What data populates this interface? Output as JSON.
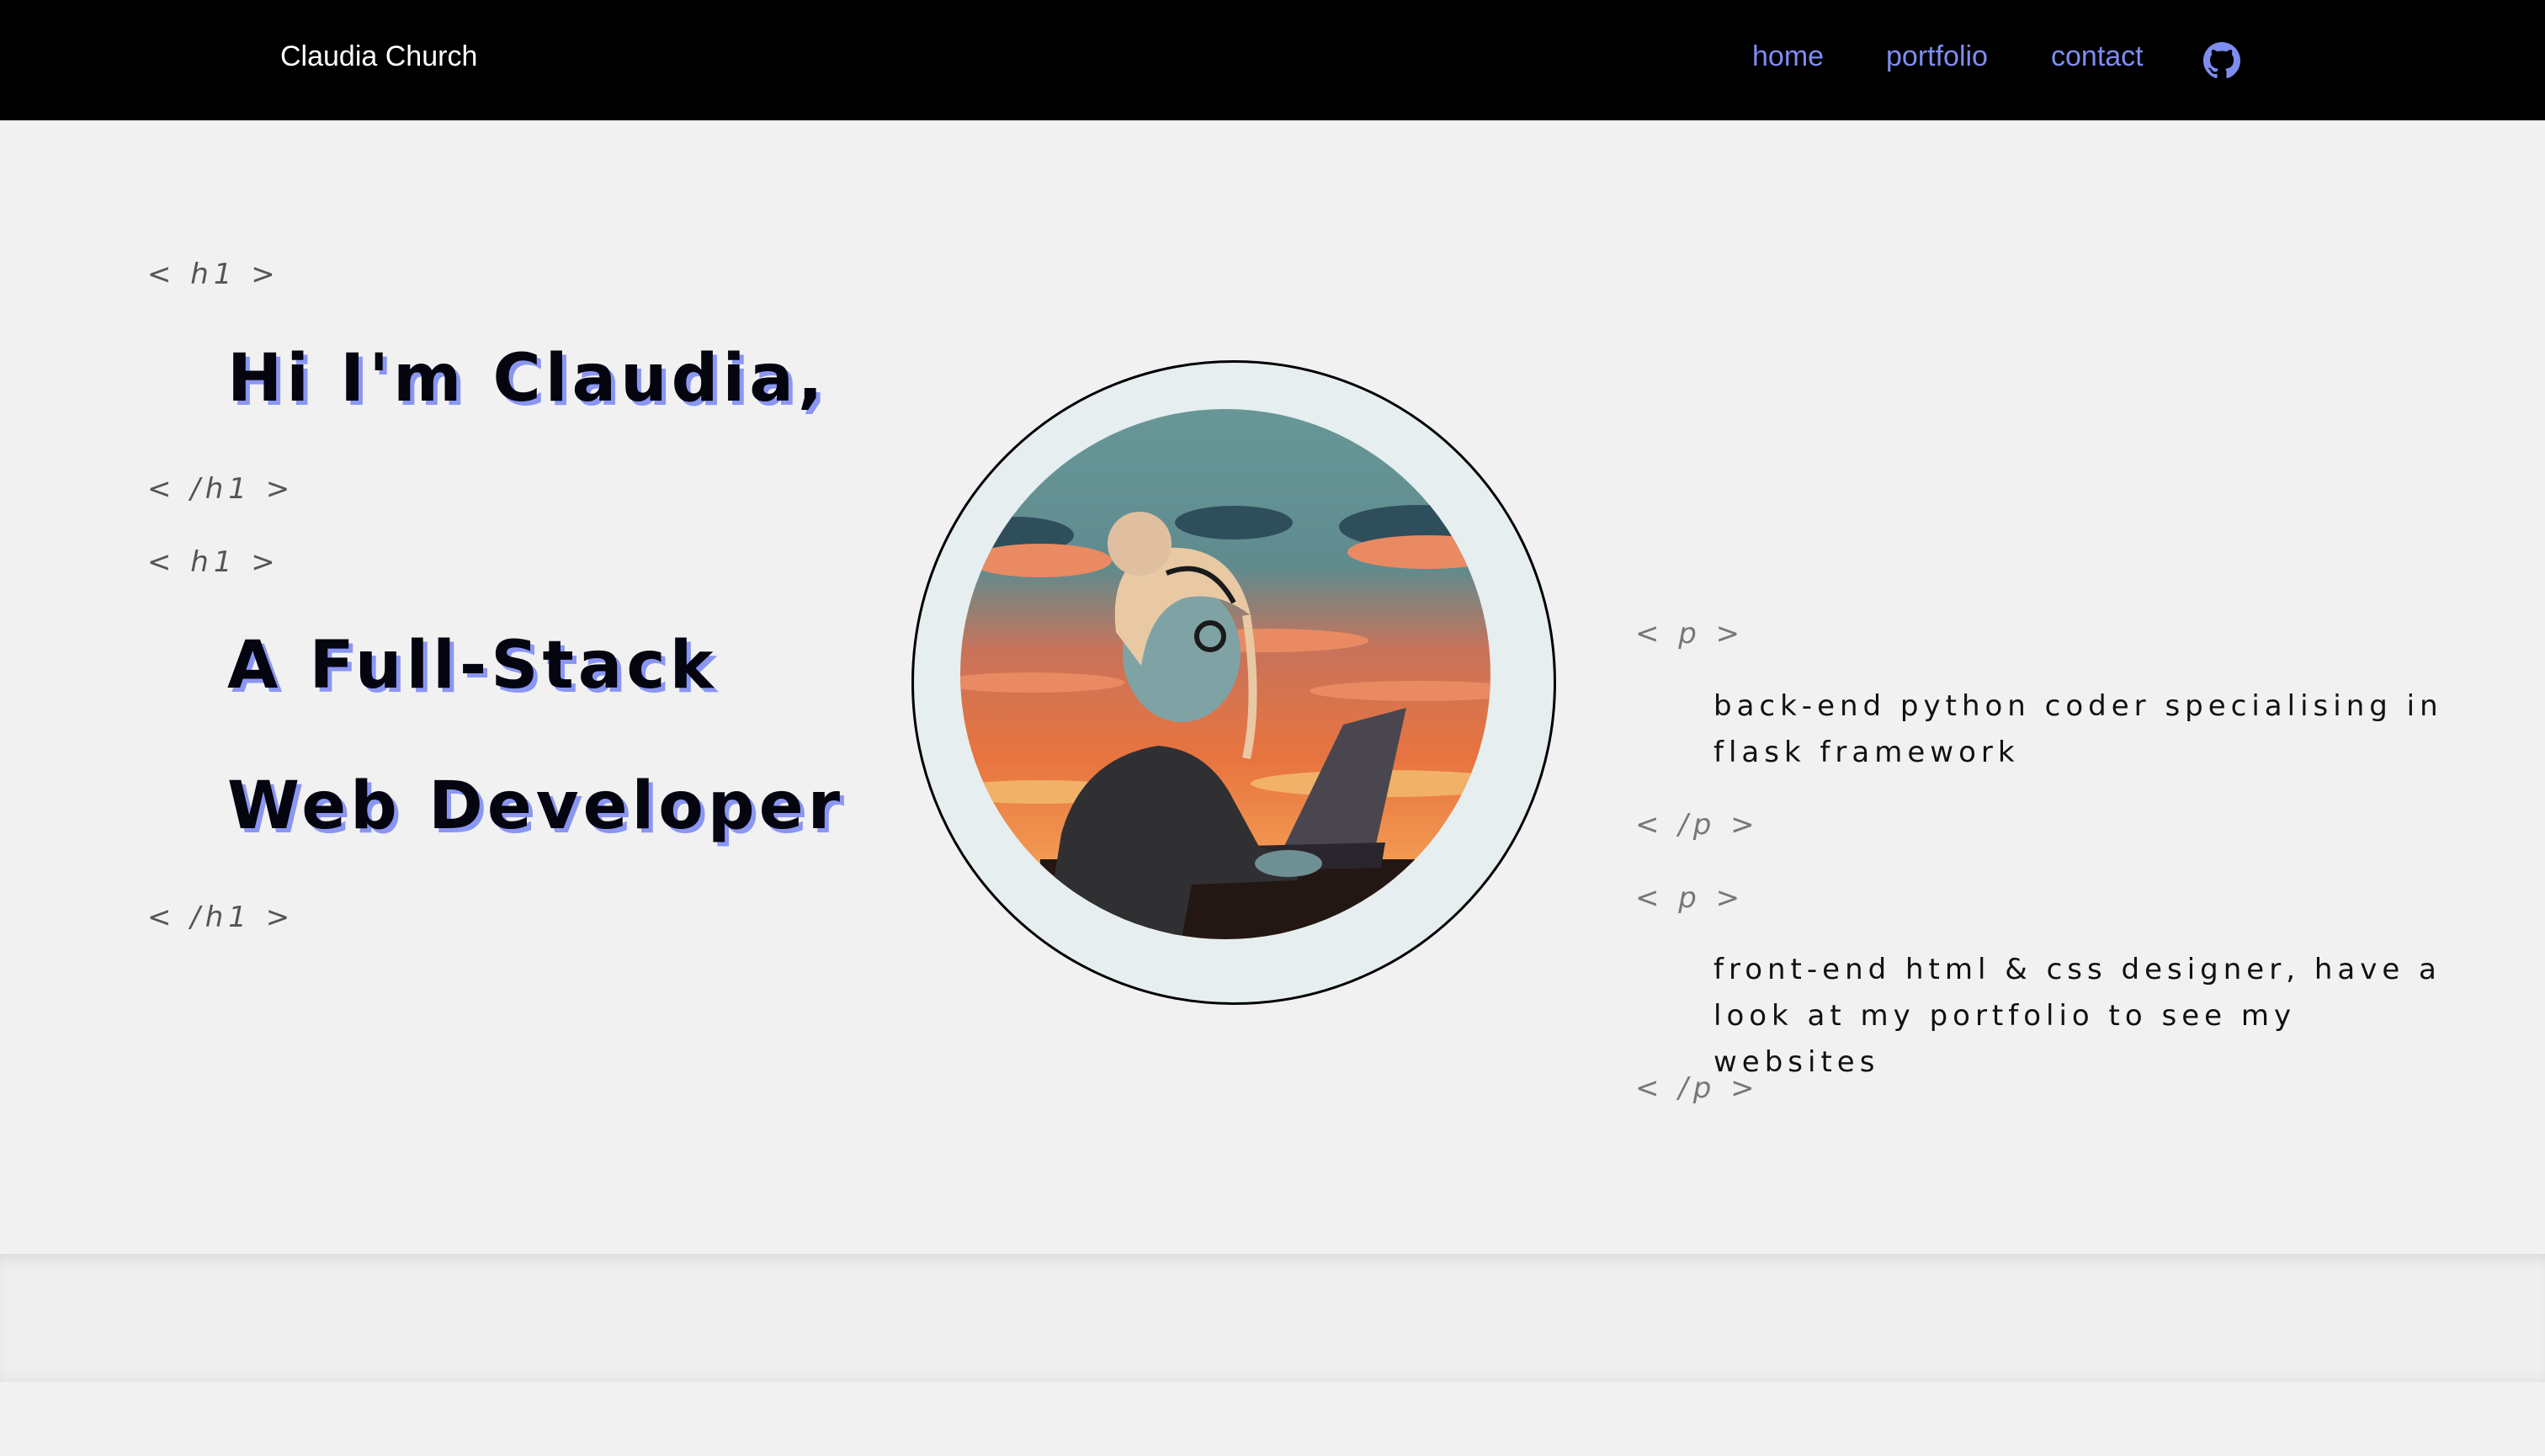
{
  "nav": {
    "brand": "Claudia Church",
    "links": [
      "home",
      "portfolio",
      "contact"
    ],
    "accent": "#7f8cf0"
  },
  "hero": {
    "tag_open": "< h1 >",
    "tag_close": "< /h1 >",
    "greeting": "Hi I'm Claudia,",
    "role_line1": "A Full-Stack",
    "role_line2": "Web Developer"
  },
  "about": {
    "tag_open": "< p >",
    "tag_close": "< /p >",
    "paragraph1": "back-end python coder specialising in flask framework",
    "paragraph2": "front-end html & css designer, have a look at my portfolio to see my websites"
  },
  "icons": {
    "github": "github-icon"
  }
}
